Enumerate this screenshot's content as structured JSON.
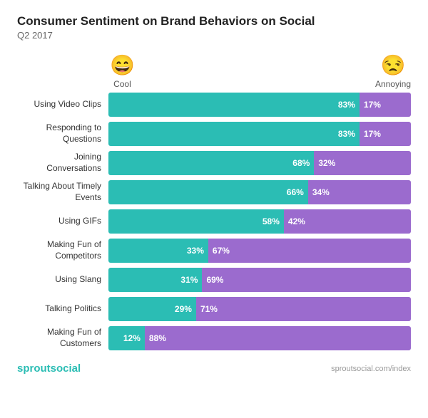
{
  "title": "Consumer Sentiment on Brand Behaviors on Social",
  "subtitle": "Q2 2017",
  "icons": {
    "cool_emoji": "😄",
    "cool_label": "Cool",
    "annoying_emoji": "😒",
    "annoying_label": "Annoying"
  },
  "rows": [
    {
      "label": "Using Video Clips",
      "cool": 83,
      "annoying": 17
    },
    {
      "label": "Responding to Questions",
      "cool": 83,
      "annoying": 17
    },
    {
      "label": "Joining Conversations",
      "cool": 68,
      "annoying": 32
    },
    {
      "label": "Talking About Timely Events",
      "cool": 66,
      "annoying": 34
    },
    {
      "label": "Using GIFs",
      "cool": 58,
      "annoying": 42
    },
    {
      "label": "Making Fun of Competitors",
      "cool": 33,
      "annoying": 67
    },
    {
      "label": "Using Slang",
      "cool": 31,
      "annoying": 69
    },
    {
      "label": "Talking Politics",
      "cool": 29,
      "annoying": 71
    },
    {
      "label": "Making Fun of Customers",
      "cool": 12,
      "annoying": 88
    }
  ],
  "footer": {
    "brand_prefix": "sprout",
    "brand_suffix": "social",
    "url": "sproutsocial.com/index"
  }
}
